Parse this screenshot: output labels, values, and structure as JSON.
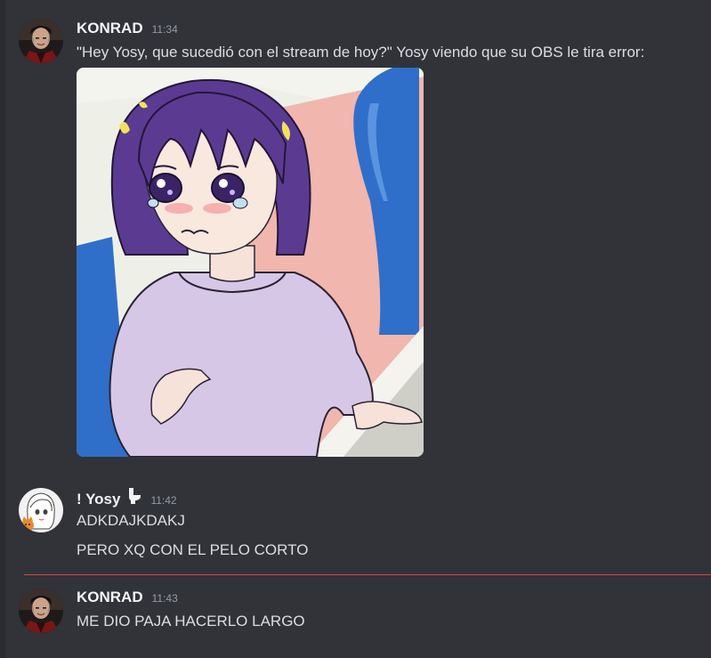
{
  "messages": [
    {
      "author": "KONRAD",
      "time": "11:34",
      "lines": [
        "\"Hey Yosy, que sucedió con el stream de hoy?\" Yosy viendo que su OBS le tira error:"
      ],
      "attachment": "anime-girl-crying-image"
    },
    {
      "author": "! Yosy",
      "time": "11:42",
      "lines": [
        "ADKDAJKDAKJ",
        "PERO XQ CON EL PELO CORTO"
      ]
    },
    {
      "author": "KONRAD",
      "time": "11:43",
      "lines": [
        "ME DIO PAJA HACERLO LARGO"
      ]
    }
  ],
  "colors": {
    "background": "#313338",
    "username": "#f2f3f5",
    "text": "#dbdee1",
    "timestamp": "#949ba4",
    "new_messages_divider": "#e04448"
  },
  "icons": {
    "role_badge": "toilet-icon"
  }
}
